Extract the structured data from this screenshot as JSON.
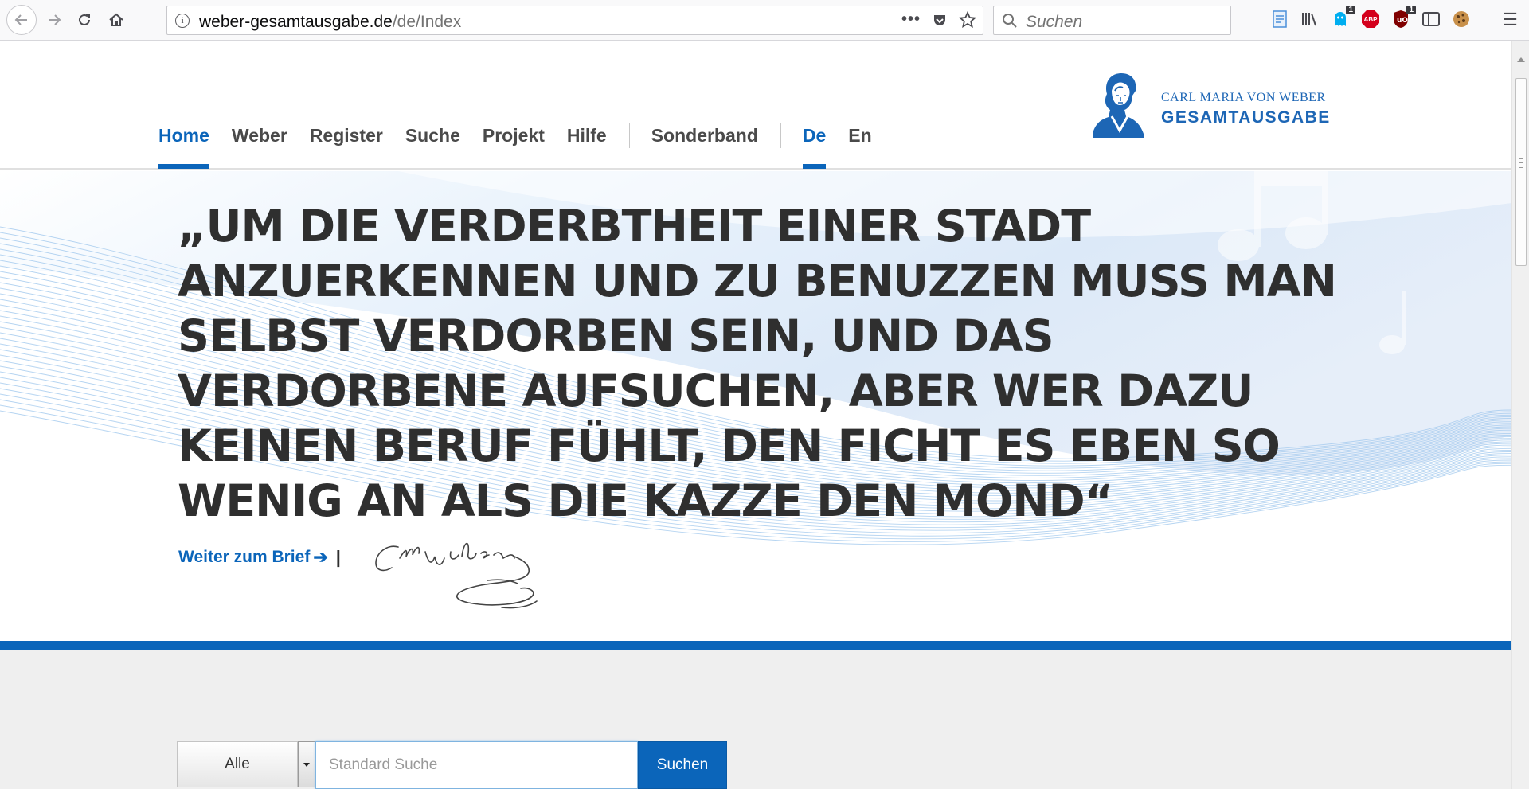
{
  "browser": {
    "url_domain": "weber-gesamtausgabe.de",
    "url_path": "/de/Index",
    "search_placeholder": "Suchen",
    "extension_badges": [
      "1",
      "1"
    ],
    "adblock_label": "ABP"
  },
  "nav": {
    "items": [
      "Home",
      "Weber",
      "Register",
      "Suche",
      "Projekt",
      "Hilfe"
    ],
    "special": "Sonderband",
    "languages": [
      "De",
      "En"
    ],
    "active": "Home",
    "active_language": "De"
  },
  "logo": {
    "line1": "CARL MARIA VON WEBER",
    "line2": "GESAMTAUSGABE"
  },
  "hero": {
    "quote": "„Um die Verderbtheit einer Stadt anzuerkennen und zu benuzzen muss man selbst verdorben sein, und das Verdorbene aufsuchen, aber wer dazu keinen Beruf fühlt, den ficht es eben so wenig an als die Kazze den Mond“",
    "link_label": "Weiter zum Brief",
    "separator": "|"
  },
  "search": {
    "select_value": "Alle",
    "input_placeholder": "Standard Suche",
    "button_label": "Suchen"
  },
  "colors": {
    "accent": "#0b65ba",
    "text": "#2f2f2f",
    "search_bg": "#efefef"
  }
}
